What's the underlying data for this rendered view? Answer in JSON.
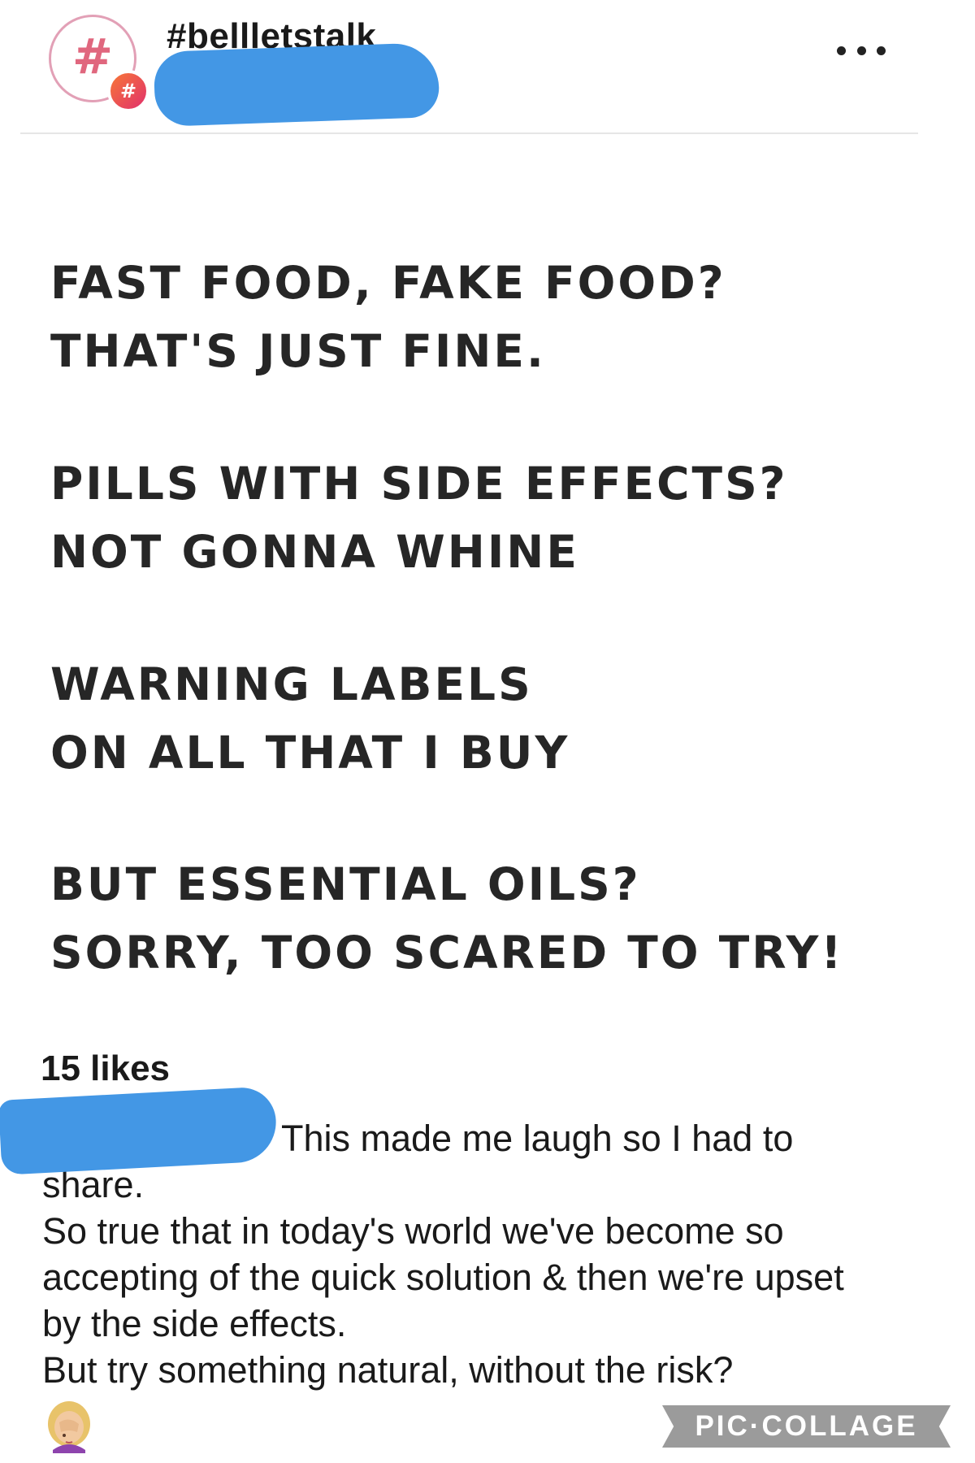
{
  "post": {
    "hashtag": "#bellletstalk",
    "avatar_symbol": "#",
    "badge_symbol": "#",
    "menu_icon": "more-horizontal-icon"
  },
  "image_text": {
    "stanzas": [
      [
        "FAST FOOD, FAKE FOOD?",
        "THAT'S JUST FINE."
      ],
      [
        "PILLS WITH SIDE EFFECTS?",
        "NOT GONNA WHINE"
      ],
      [
        "WARNING LABELS",
        "ON ALL THAT I BUY"
      ],
      [
        "BUT ESSENTIAL OILS?",
        "SORRY, TOO SCARED TO TRY!"
      ]
    ]
  },
  "engagement": {
    "likes": "15 likes"
  },
  "caption": {
    "first_line": "This made me laugh so I had to share.",
    "line_2": "So true that in today's world we've become so accepting of the quick solution & then we're upset by the side effects.",
    "line_3": "But try something natural, without the risk?",
    "emoji": "woman-facepalming-icon"
  },
  "watermark": "PIC·COLLAGE",
  "colors": {
    "redaction": "#4397e5",
    "badge_gradient_start": "#f77737",
    "badge_gradient_end": "#e1306c",
    "avatar_hash": "#e0677e"
  }
}
